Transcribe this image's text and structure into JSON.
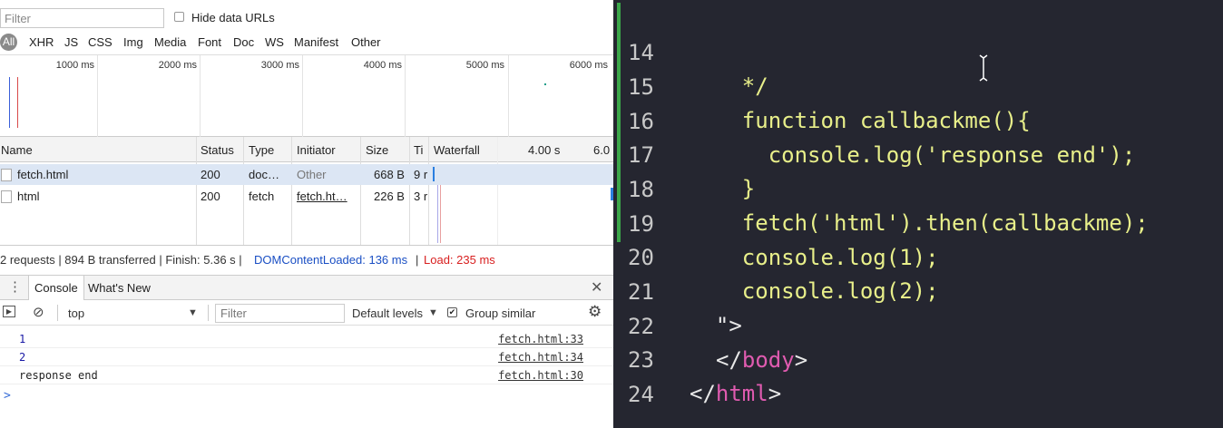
{
  "network": {
    "filter_placeholder": "Filter",
    "hide_data_urls": "Hide data URLs",
    "types": [
      "All",
      "XHR",
      "JS",
      "CSS",
      "Img",
      "Media",
      "Font",
      "Doc",
      "WS",
      "Manifest",
      "Other"
    ],
    "timeline_ticks": [
      "1000 ms",
      "2000 ms",
      "3000 ms",
      "4000 ms",
      "5000 ms",
      "6000 ms"
    ],
    "columns": {
      "name": "Name",
      "status": "Status",
      "type": "Type",
      "initiator": "Initiator",
      "size": "Size",
      "time": "Ti",
      "waterfall": "Waterfall",
      "wf_4s": "4.00 s",
      "wf_6s": "6.0"
    },
    "rows": [
      {
        "name": "fetch.html",
        "status": "200",
        "type": "doc…",
        "initiator": "Other",
        "size": "668 B",
        "time": "9 r"
      },
      {
        "name": "html",
        "status": "200",
        "type": "fetch",
        "initiator": "fetch.ht…",
        "size": "226 B",
        "time": "3 r"
      }
    ],
    "summary": {
      "requests": "2 requests | 894 B transferred | Finish: 5.36 s | ",
      "dom": "DOMContentLoaded: 136 ms",
      "sep": " | ",
      "load": "Load: 235 ms"
    }
  },
  "drawer": {
    "tab_console": "Console",
    "tab_whats_new": "What's New",
    "context": "top",
    "filter_placeholder": "Filter",
    "levels": "Default levels",
    "group_similar": "Group similar",
    "lines": [
      {
        "msg": "1",
        "src": "fetch.html:33"
      },
      {
        "msg": "2",
        "src": "fetch.html:34"
      },
      {
        "msg": "response end",
        "src": "fetch.html:30"
      }
    ],
    "prompt": ">"
  },
  "editor": {
    "lines": [
      {
        "n": "14",
        "code": "    */"
      },
      {
        "n": "15",
        "code": "    function callbackme(){"
      },
      {
        "n": "16",
        "code": "      console.log('response end');"
      },
      {
        "n": "17",
        "code": "    }"
      },
      {
        "n": "18",
        "code": "    fetch('html').then(callbackme);"
      },
      {
        "n": "19",
        "code": "    console.log(1);"
      },
      {
        "n": "20",
        "code": "    console.log(2);"
      },
      {
        "n": "21",
        "code": "  \">"
      },
      {
        "n": "22",
        "code_open": "</",
        "code_tag": "body",
        "code_close": ">"
      },
      {
        "n": "23",
        "code_open": "</",
        "code_tag": "html",
        "code_close": ">"
      },
      {
        "n": "24",
        "code": ""
      }
    ]
  },
  "colors": {
    "editor_bg": "#252630",
    "code_yellow": "#e8ef8a",
    "tag_pink": "#e05bb0",
    "dom_blue": "#1a4fc4",
    "load_red": "#d82020"
  }
}
